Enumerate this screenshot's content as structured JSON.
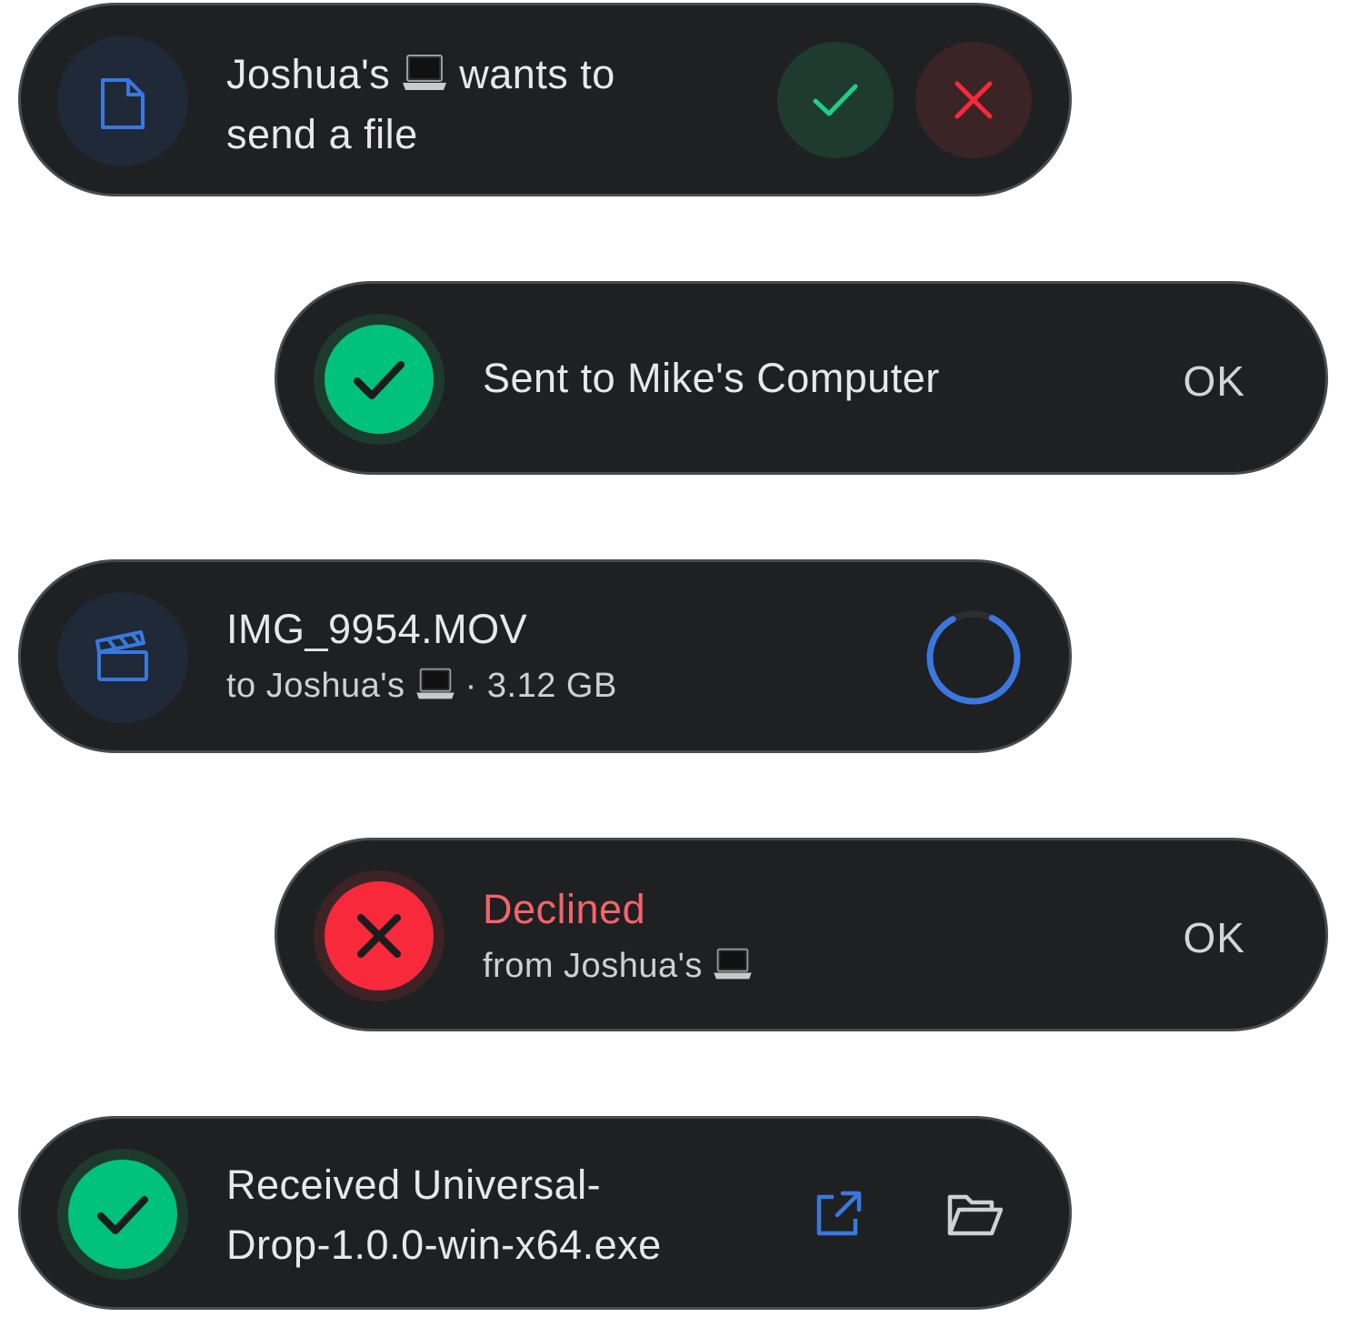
{
  "toasts": {
    "incoming": {
      "line1_before": "Joshua's",
      "line1_after": "wants to",
      "line2": "send a file",
      "device_emoji": "laptop-icon",
      "accept_icon": "check-icon",
      "decline_icon": "x-icon"
    },
    "sent": {
      "text": "Sent to Mike's Computer",
      "ok_label": "OK"
    },
    "transfer": {
      "filename": "IMG_9954.MOV",
      "sub_before": "to Joshua's",
      "sub_after": "· 3.12 GB",
      "progress_fraction": 0.85
    },
    "declined": {
      "title": "Declined",
      "sub_before": "from Joshua's",
      "ok_label": "OK"
    },
    "received": {
      "line1": "Received Universal-",
      "line2": "Drop-1.0.0-win-x64.exe",
      "open_icon": "external-link-icon",
      "folder_icon": "folder-open-icon"
    }
  },
  "colors": {
    "toast_bg": "#1f2021",
    "toast_border": "#4a4b4c",
    "accent_blue": "#3a78e0",
    "success_green": "#00c27c",
    "error_red": "#f8293a",
    "declined_text": "#f4646b"
  }
}
